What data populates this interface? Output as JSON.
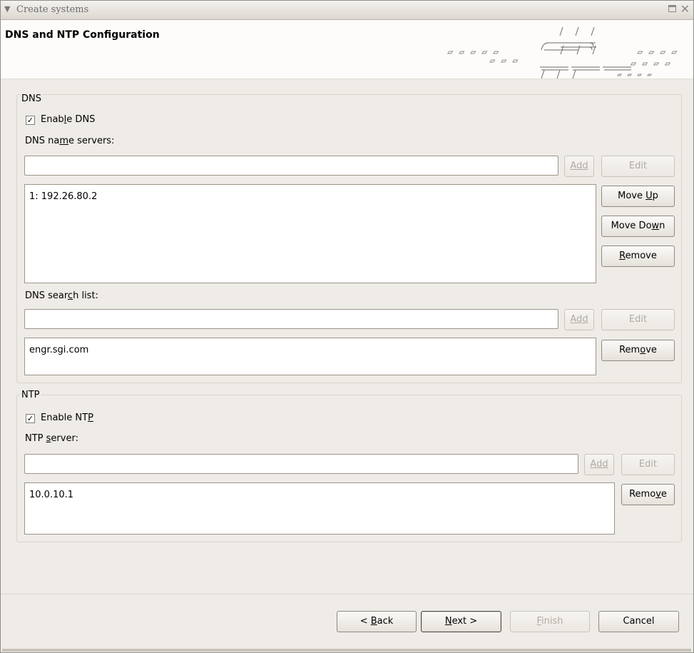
{
  "window": {
    "title": "Create systems"
  },
  "header": {
    "title": "DNS and NTP Configuration"
  },
  "dns": {
    "group_label": "DNS",
    "enable": {
      "label_pre": "Enab",
      "label_u": "l",
      "label_post": "e DNS",
      "checked": true
    },
    "name_servers": {
      "label_pre": "DNS na",
      "label_u": "m",
      "label_post": "e servers:",
      "input_value": "",
      "add_label": "Add",
      "edit_label": "Edit",
      "items": [
        "1: 192.26.80.2"
      ],
      "move_up": {
        "pre": "Move ",
        "u": "U",
        "post": "p"
      },
      "move_down": {
        "pre": "Move Do",
        "u": "w",
        "post": "n"
      },
      "remove": {
        "pre": "",
        "u": "R",
        "post": "emove"
      }
    },
    "search_list": {
      "label_pre": "DNS sear",
      "label_u": "c",
      "label_post": "h list:",
      "input_value": "",
      "add_label": "Add",
      "edit_label": "Edit",
      "items": [
        "engr.sgi.com"
      ],
      "remove": {
        "pre": "Rem",
        "u": "o",
        "post": "ve"
      }
    }
  },
  "ntp": {
    "group_label": "NTP",
    "enable": {
      "label_pre": "Enable NT",
      "label_u": "P",
      "label_post": "",
      "checked": true
    },
    "server": {
      "label_pre": "NTP ",
      "label_u": "s",
      "label_post": "erver:",
      "input_value": "",
      "add_label": "Add",
      "edit_label": "Edit",
      "items": [
        "10.0.10.1"
      ],
      "remove": {
        "pre": "Remo",
        "u": "v",
        "post": "e"
      }
    }
  },
  "footer": {
    "back": {
      "pre": "< ",
      "u": "B",
      "post": "ack"
    },
    "next": {
      "pre": "",
      "u": "N",
      "post": "ext >"
    },
    "finish": {
      "pre": "",
      "u": "F",
      "post": "inish"
    },
    "cancel": "Cancel"
  }
}
